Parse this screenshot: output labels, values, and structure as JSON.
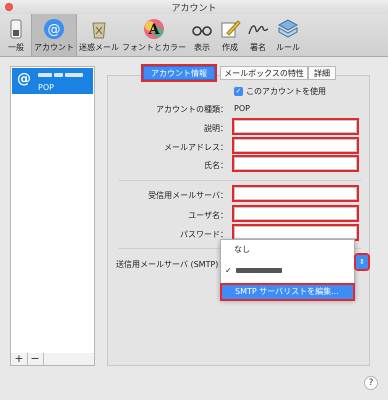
{
  "window": {
    "title": "アカウント"
  },
  "toolbar": {
    "items": [
      {
        "label": "一般",
        "icon": "switch-icon"
      },
      {
        "label": "アカウント",
        "icon": "at-icon",
        "selected": true
      },
      {
        "label": "迷惑メール",
        "icon": "trash-icon"
      },
      {
        "label": "フォントとカラー",
        "icon": "font-color-icon"
      },
      {
        "label": "表示",
        "icon": "glasses-icon"
      },
      {
        "label": "作成",
        "icon": "compose-icon"
      },
      {
        "label": "署名",
        "icon": "signature-icon"
      },
      {
        "label": "ルール",
        "icon": "rules-icon"
      }
    ]
  },
  "sidebar": {
    "account": {
      "icon": "@",
      "type": "POP"
    },
    "add_label": "+",
    "remove_label": "−"
  },
  "tabs": [
    "アカウント情報",
    "メールボックスの特性",
    "詳細"
  ],
  "account_info": {
    "enable_label": "このアカウントを使用",
    "enabled": true,
    "type_label": "アカウントの種類：",
    "type_value": "POP",
    "description_label": "説明：",
    "email_label": "メールアドレス：",
    "fullname_label": "氏名：",
    "incoming_label": "受信用メールサーバ：",
    "username_label": "ユーザ名：",
    "password_label": "パスワード：",
    "smtp_label": "送信用メールサーバ (SMTP)："
  },
  "smtp_menu": {
    "none": "なし",
    "check": "✓",
    "edit": "SMTP サーバリストを編集..."
  },
  "help": "?",
  "colors": {
    "accent": "#3e8df7",
    "highlight_box": "#e0282f"
  }
}
